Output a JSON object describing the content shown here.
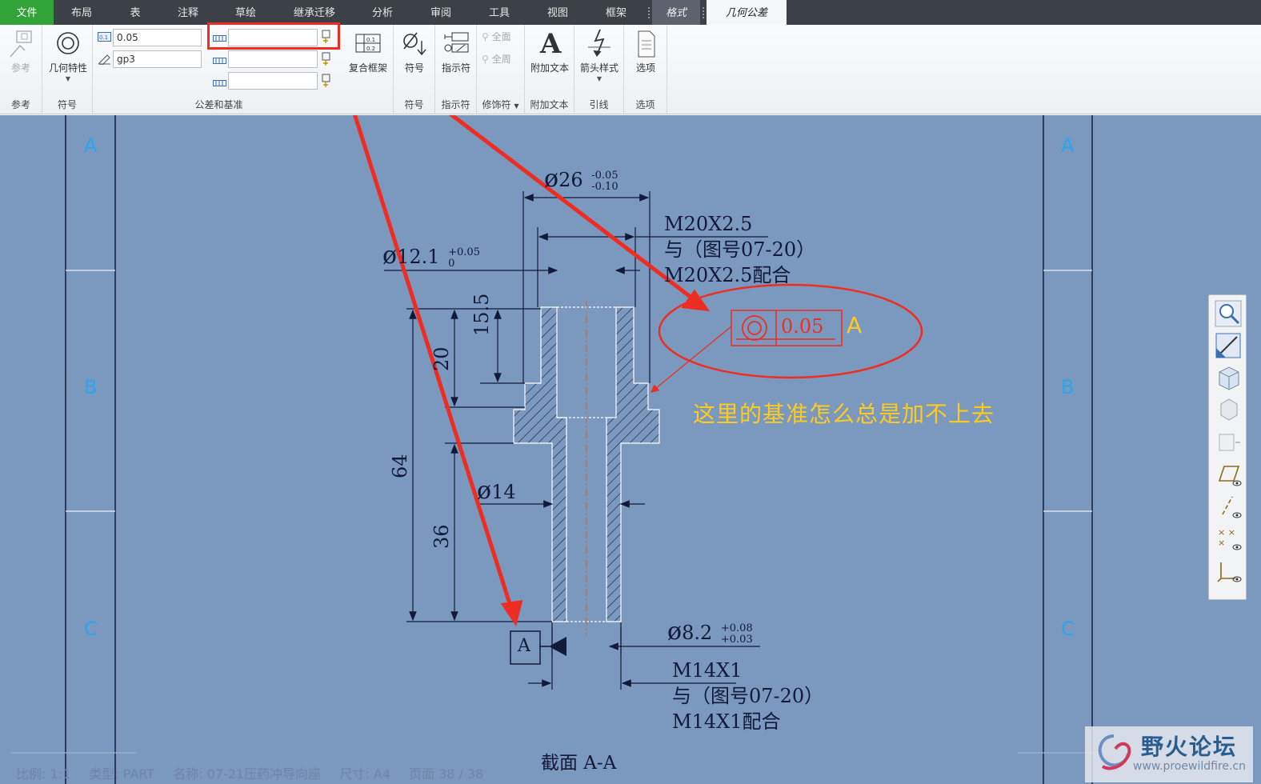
{
  "menu": {
    "tabs": [
      "文件",
      "布局",
      "表",
      "注释",
      "草绘",
      "继承迁移",
      "分析",
      "审阅",
      "工具",
      "视图",
      "框架",
      "格式",
      "几何公差"
    ]
  },
  "ribbon": {
    "reference": {
      "button": "参考",
      "group": "参考"
    },
    "symbol_group": {
      "button": "几何特性",
      "group": "符号"
    },
    "tolerance": {
      "value": "0.05",
      "name": "gp3",
      "datum_primary": "",
      "datum_secondary": "",
      "datum_tertiary": "",
      "group": "公差和基准"
    },
    "composite_frame": "复合框架",
    "symbol": {
      "button": "符号",
      "group": "符号"
    },
    "indicator": {
      "button": "指示符",
      "group": "指示符"
    },
    "modifier": {
      "all_around": "全面",
      "all_over": "全周",
      "group": "修饰符"
    },
    "add_text": {
      "button": "附加文本",
      "group": "附加文本"
    },
    "arrow": {
      "button": "箭头样式",
      "group": "引线"
    },
    "options": {
      "button": "选项",
      "group": "选项"
    }
  },
  "drawing": {
    "zones": [
      "A",
      "B",
      "C"
    ],
    "dims": {
      "d26": "26",
      "d26_tol_up": "-0.05",
      "d26_tol_low": "-0.10",
      "m20_line1": "M20X2.5",
      "m20_line2": "与（图号07-20）",
      "m20_line3": "M20X2.5配合",
      "d12": "12.1",
      "d12_tol_up": "+0.05",
      "d12_tol_low": "0",
      "v155": "15.5",
      "v20": "20",
      "v64": "64",
      "v36": "36",
      "d14": "14",
      "d82": "8.2",
      "d82_tol_up": "+0.08",
      "d82_tol_low": "+0.03",
      "m14_line1": "M14X1",
      "m14_line2": "与（图号07-20）",
      "m14_line3": "M14X1配合"
    },
    "gtol": {
      "value": "0.05",
      "datum": "A"
    },
    "datum_box": "A",
    "section_title": "截面 A-A",
    "question": "这里的基准怎么总是加不上去"
  },
  "status": {
    "scale": "比例: 1:1",
    "type": "类型: PART",
    "name": "名称: 07-21压药冲导向座",
    "size": "尺寸: A4",
    "page": "页面 38  / 38"
  },
  "watermark": {
    "title": "野火论坛",
    "url": "www.proewildfire.cn"
  },
  "colors": {
    "canvas": "#7b98be",
    "geometry": "#121a3a",
    "highlight": "#ee2d22",
    "question": "#ffcb1f",
    "zone": "#2aa6f0",
    "file_tab": "#32a336"
  }
}
